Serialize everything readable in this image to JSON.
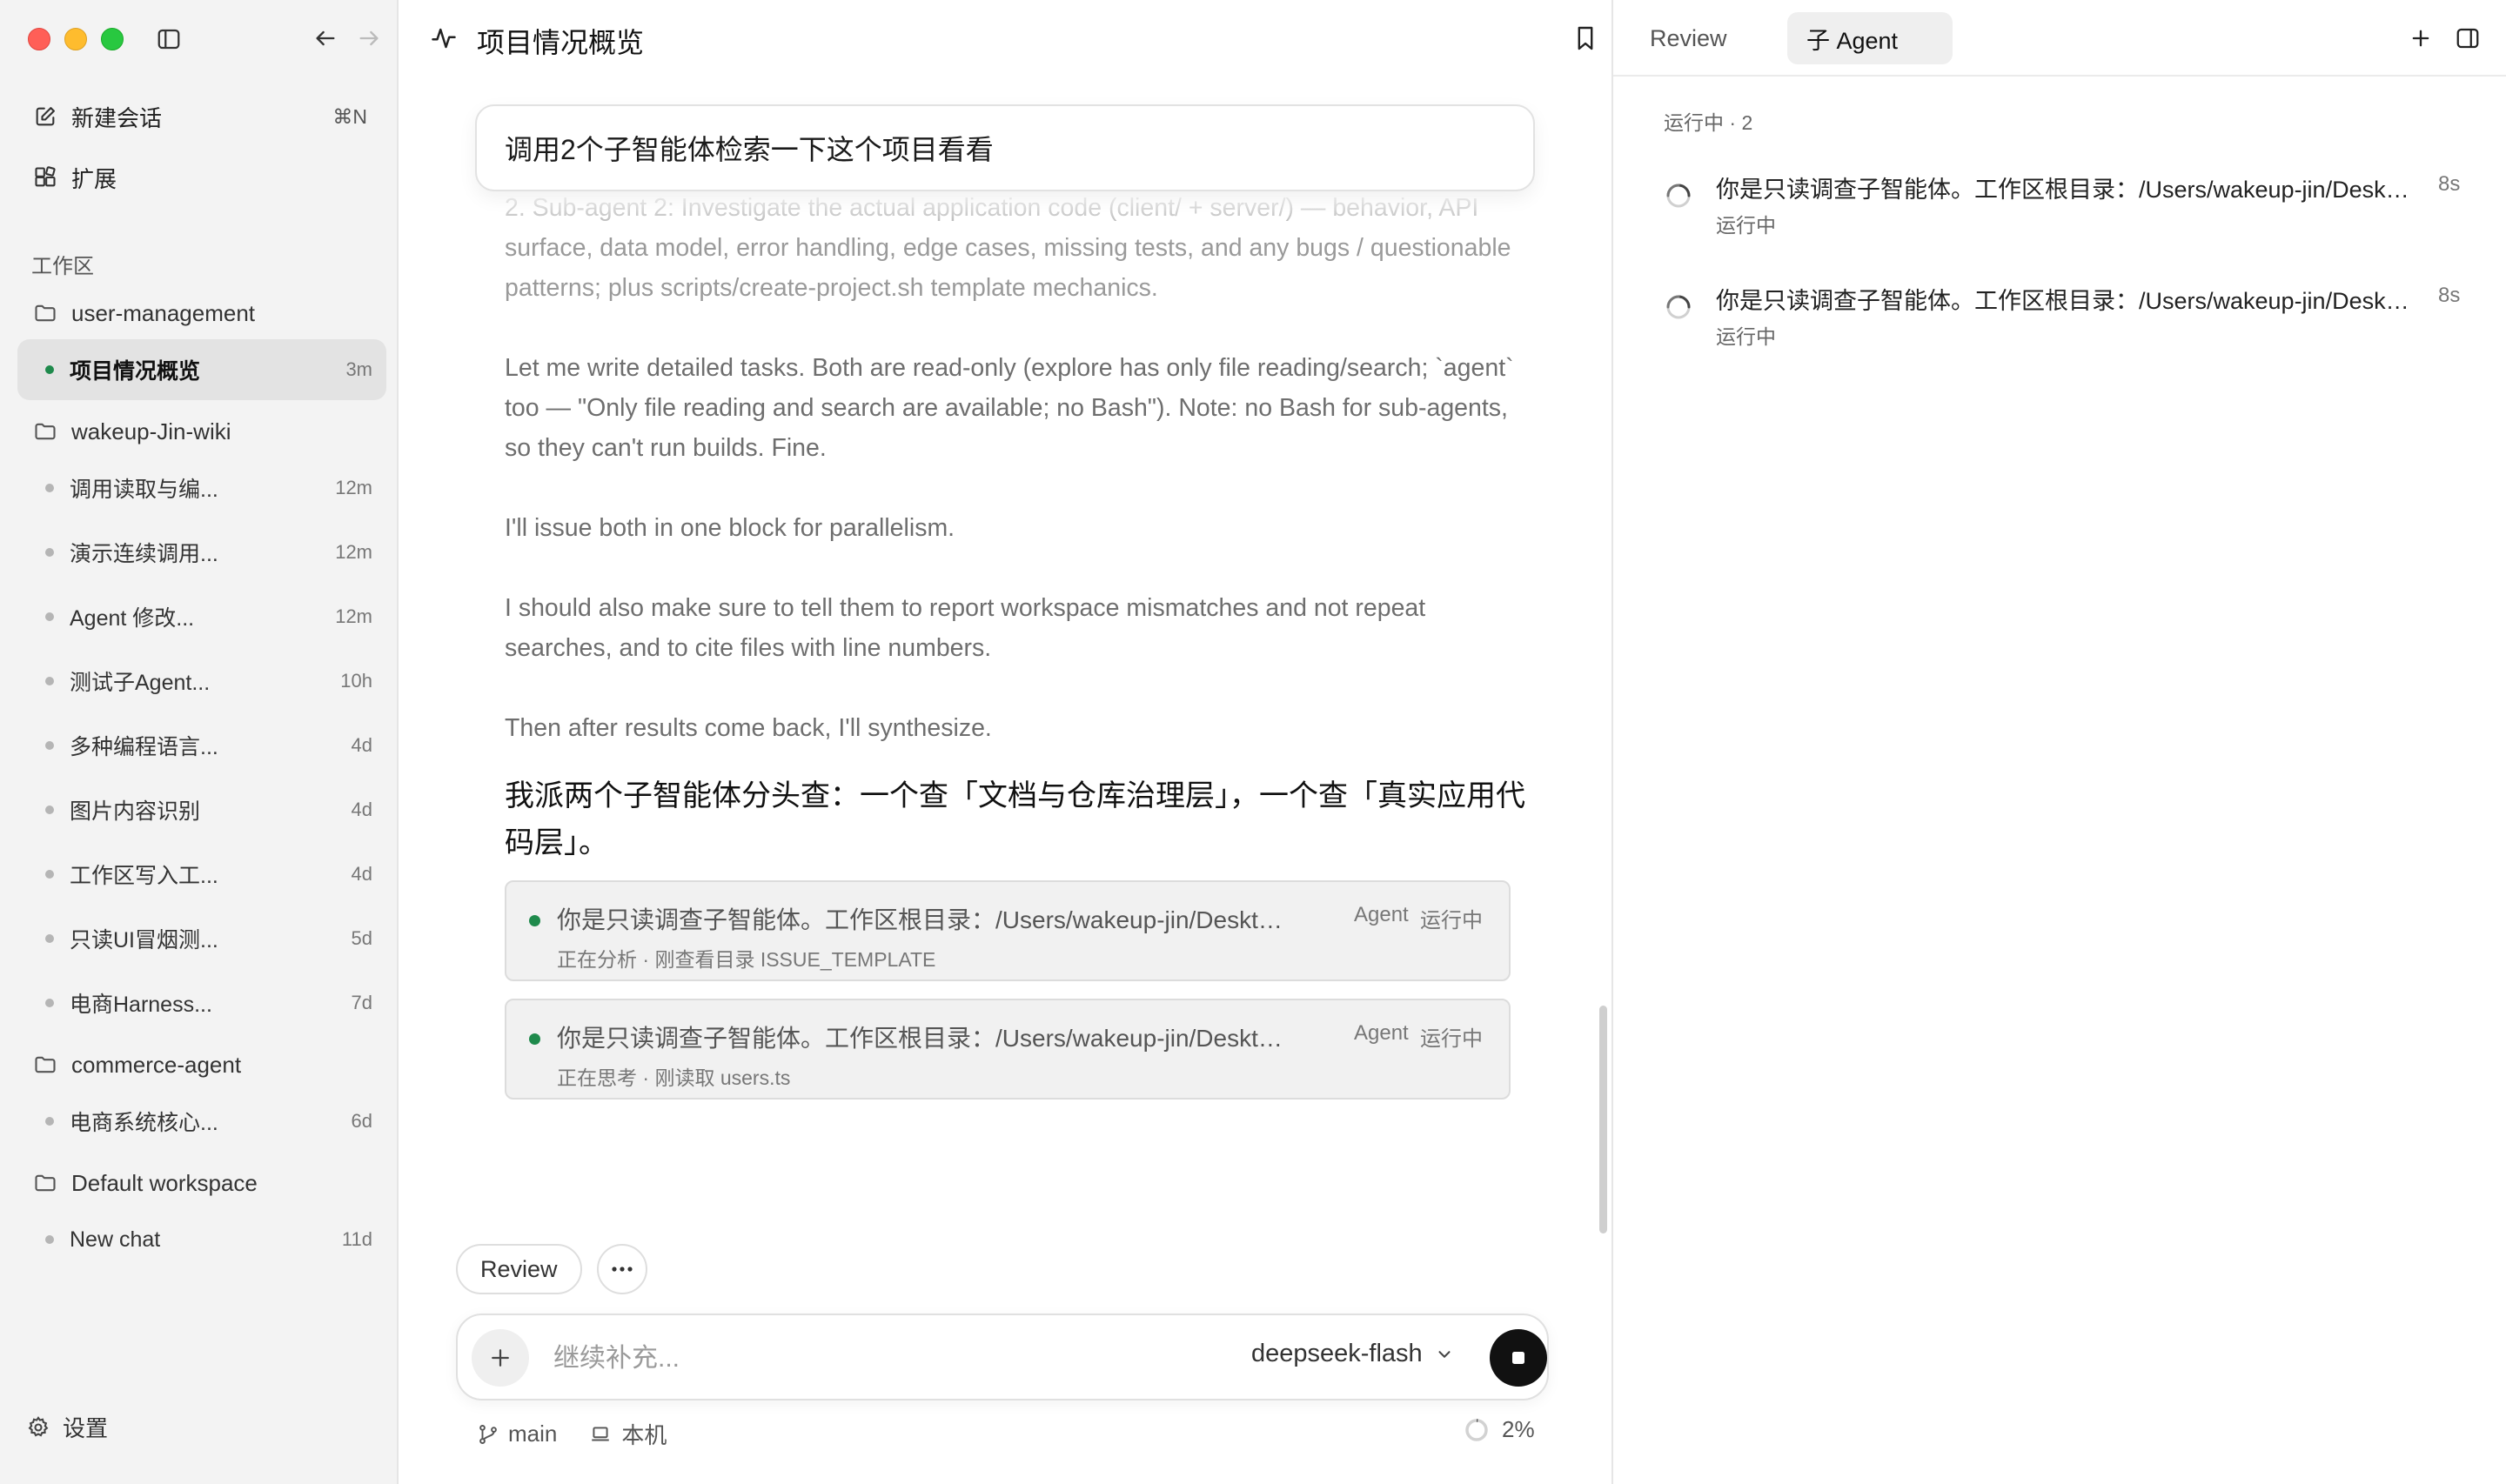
{
  "sidebar": {
    "new_chat": {
      "label": "新建会话",
      "shortcut": "⌘N",
      "icon": "compose-icon"
    },
    "extensions": {
      "label": "扩展",
      "icon": "extensions-icon"
    },
    "workspace_section": "工作区",
    "workspaces": [
      {
        "name": "user-management",
        "chats": [
          {
            "title": "项目情况概览",
            "age": "3m",
            "active": true
          }
        ]
      },
      {
        "name": "wakeup-Jin-wiki",
        "chats": [
          {
            "title": "调用读取与编...",
            "age": "12m"
          },
          {
            "title": "演示连续调用...",
            "age": "12m"
          },
          {
            "title": "Agent 修改...",
            "age": "12m"
          },
          {
            "title": "测试子Agent...",
            "age": "10h"
          },
          {
            "title": "多种编程语言...",
            "age": "4d"
          },
          {
            "title": "图片内容识别",
            "age": "4d"
          },
          {
            "title": "工作区写入工...",
            "age": "4d"
          },
          {
            "title": "只读UI冒烟测...",
            "age": "5d"
          },
          {
            "title": "电商Harness...",
            "age": "7d"
          }
        ]
      },
      {
        "name": "commerce-agent",
        "chats": [
          {
            "title": "电商系统核心...",
            "age": "6d"
          }
        ]
      },
      {
        "name": "Default workspace",
        "chats": [
          {
            "title": "New chat",
            "age": "11d"
          }
        ]
      }
    ],
    "settings_label": "设置"
  },
  "main": {
    "title": "项目情况概览",
    "user_message": "调用2个子智能体检索一下这个项目看看",
    "thinking": [
      "2. Sub-agent 2: Investigate the actual application code (client/ + server/) — behavior, API surface, data model, error handling, edge cases, missing tests, and any bugs / questionable patterns; plus scripts/create-project.sh template mechanics.",
      "Let me write detailed tasks. Both are read-only (explore has only file reading/search; `agent` too — \"Only file reading and search are available; no Bash\"). Note: no Bash for sub-agents, so they can't run builds. Fine.",
      "I'll issue both in one block for parallelism.",
      "I should also make sure to tell them to report workspace mismatches and not repeat searches, and to cite files with line numbers.",
      "Then after results come back, I'll synthesize."
    ],
    "assistant_message": "我派两个子智能体分头查：一个查「文档与仓库治理层」，一个查「真实应用代码层」。",
    "agent_cards": [
      {
        "prompt": "你是只读调查子智能体。工作区根目录：/Users/wakeup-jin/Desktop/...",
        "tag": "Agent",
        "state": "运行中",
        "activity": "正在分析 · 刚查看目录 ISSUE_TEMPLATE"
      },
      {
        "prompt": "你是只读调查子智能体。工作区根目录：/Users/wakeup-jin/Desktop/...",
        "tag": "Agent",
        "state": "运行中",
        "activity": "正在思考 · 刚读取 users.ts"
      }
    ],
    "chips": {
      "review": "Review"
    },
    "composer": {
      "placeholder": "继续补充...",
      "value": "",
      "model": "deepseek-flash"
    },
    "status": {
      "branch": "main",
      "location": "本机",
      "context_usage": "2%",
      "context_fraction": 0.02
    }
  },
  "right_panel": {
    "tabs": [
      {
        "label": "Review",
        "active": false
      },
      {
        "label": "子 Agent",
        "active": true
      }
    ],
    "section": "运行中 · 2",
    "items": [
      {
        "text": "你是只读调查子智能体。工作区根目录：/Users/wakeup-jin/Desktop/...",
        "time": "8s",
        "state": "运行中"
      },
      {
        "text": "你是只读调查子智能体。工作区根目录：/Users/wakeup-jin/Desktop/...",
        "time": "8s",
        "state": "运行中"
      }
    ]
  },
  "colors": {
    "sidebar_bg": "#f3f3f3",
    "active_dot": "#1f8a4c",
    "idle_dot": "#b5b5b5",
    "card_bg": "#f1f1f1",
    "stop_button": "#111111"
  }
}
